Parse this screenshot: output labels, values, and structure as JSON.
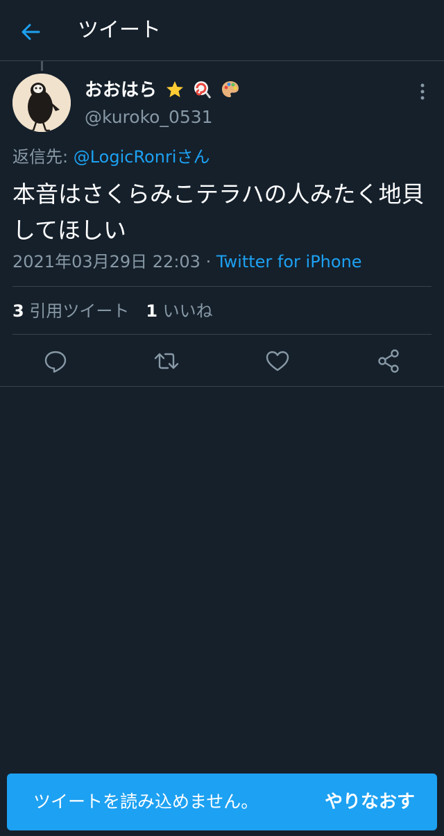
{
  "header": {
    "title": "ツイート"
  },
  "tweet": {
    "display_name": "おおはら",
    "name_emojis": [
      "star-emoji",
      "lollipop-emoji",
      "palette-emoji"
    ],
    "handle": "@kuroko_0531",
    "reply_label": "返信先: ",
    "reply_mention": "@LogicRonri",
    "reply_suffix": "さん",
    "text": "本音はさくらみこテラハの人みたく地貝してほしい",
    "timestamp": "2021年03月29日 22:03",
    "separator": " · ",
    "source": "Twitter for iPhone"
  },
  "stats": {
    "quote_count": "3",
    "quote_label": " 引用ツイート",
    "like_count": "1",
    "like_label": " いいね"
  },
  "actions": [
    "reply-icon",
    "retweet-icon",
    "like-icon",
    "share-icon"
  ],
  "toast": {
    "message": "ツイートを読み込めません。",
    "retry_label": "やりなおす"
  },
  "colors": {
    "background": "#15202b",
    "accent": "#1da1f2",
    "secondary_text": "#8899a6",
    "divider": "#38444d"
  }
}
